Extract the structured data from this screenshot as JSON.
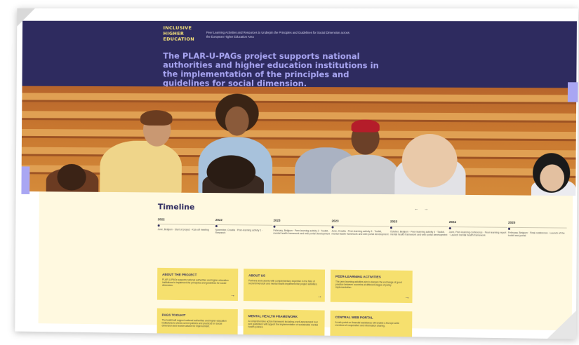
{
  "header": {
    "logo_line1": "INCLUSIVE",
    "logo_line2": "HIGHER",
    "logo_line3": "EDUCATION",
    "tagline": "Peer Learning Activities and Resources to Underpin the Principles and Guidelines for Social Dimension across the European Higher Education Area",
    "headline": "The PLAR-U-PAGs project supports national authorities and higher education institutions in the implementation of the principles and guidelines for social dimension."
  },
  "timeline": {
    "title": "Timeline",
    "prev_icon": "arrow-left-icon",
    "next_icon": "arrow-right-icon",
    "prev_label": "←",
    "next_label": "→",
    "items": [
      {
        "year": "2022",
        "text": "June, Belgium · Start of project · Kick-off meeting"
      },
      {
        "year": "2022",
        "text": "November, Croatia · Peer-learning activity 1 · Research"
      },
      {
        "year": "2023",
        "text": "February, Belgium · Peer-learning activity 2 · Toolkit, mental health framework and web portal development"
      },
      {
        "year": "2023",
        "text": "June, Croatia · Peer-learning activity 3 · Toolkit, mental health framework and web portal development"
      },
      {
        "year": "2023",
        "text": "October, Belgium · Peer-learning activity 4 · Toolkit, mental health framework and web portal development"
      },
      {
        "year": "2024",
        "text": "June, Peer-learning conference · Peer-learning report · Launch mental health framework"
      },
      {
        "year": "2025",
        "text": "February, Belgium · Final conference · Launch of the toolkit and portal"
      }
    ]
  },
  "cards": [
    {
      "title": "ABOUT THE PROJECT",
      "text": "PLAR-U-PAGs supports national authorities and higher education institutions to implement the principles and guidelines for social dimension.",
      "arrow": "→"
    },
    {
      "title": "ABOUT US",
      "text": "Partners and experts with complementary expertise in the field of social dimension and mental health implement the project activities.",
      "arrow": "→"
    },
    {
      "title": "PEER-LEARNING ACTIVITIES",
      "text": "The peer-learning activities aim to deepen the exchange of good practice between countries at different stages of policy implementation.",
      "arrow": "→"
    },
    {
      "title": "PAGS TOOLKIT",
      "text": "The toolkit will support national authorities and higher education institutions to check current policies and practices on social dimension and receive advice for improvement.",
      "arrow": "→"
    },
    {
      "title": "MENTAL HEALTH FRAMEWORK",
      "text": "A comprehensive action framework including a self-assessment tool and guidelines will support the implementation of sustainable mental health policies.",
      "arrow": "→"
    },
    {
      "title": "CENTRAL WEB PORTAL",
      "text": "A web portal on financial assistance will enable a Europe-wide overview of cooperative and information sharing.",
      "arrow": "→"
    }
  ],
  "colors": {
    "header_bg": "#2e2b5f",
    "logo": "#f6e37a",
    "headline": "#a9a6f3",
    "content_bg": "#fff9e0",
    "card_bg": "#f6e06e"
  }
}
